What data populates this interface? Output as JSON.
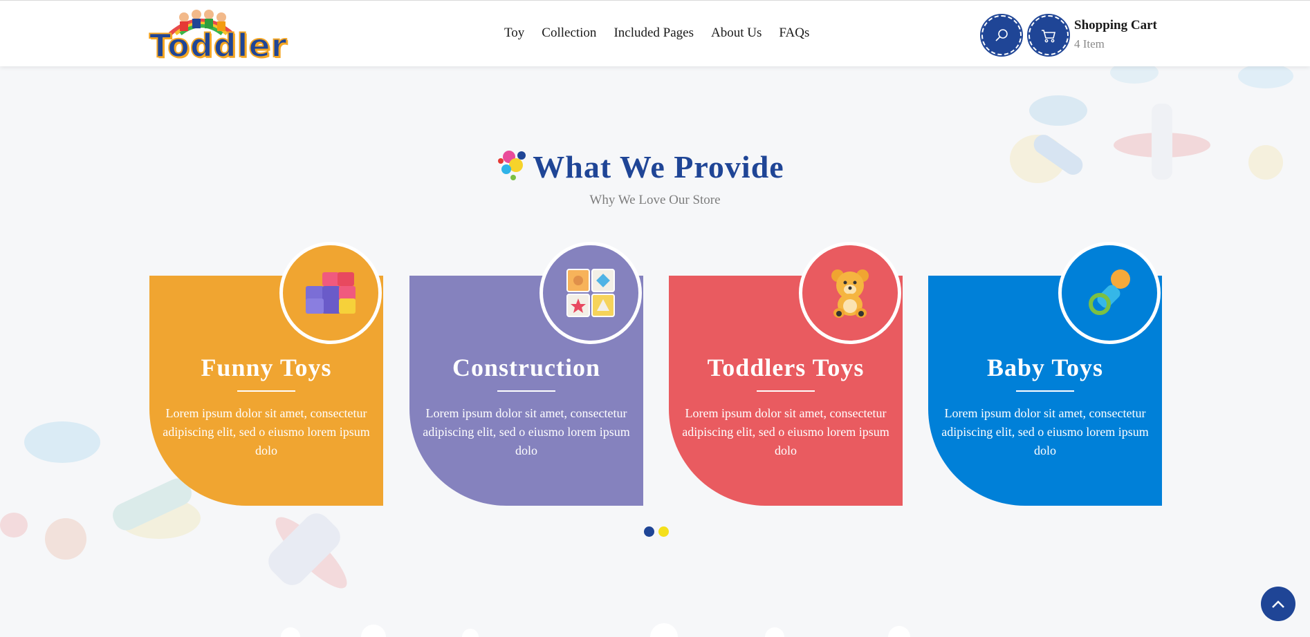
{
  "brand": {
    "logo_text": "Toddler"
  },
  "nav": {
    "items": [
      "Toy",
      "Collection",
      "Included Pages",
      "About Us",
      "FAQs"
    ]
  },
  "header": {
    "search_icon": "search-icon",
    "cart_icon": "cart-icon",
    "cart_title": "Shopping Cart",
    "cart_count": "4 Item"
  },
  "section": {
    "title": "What We Provide",
    "subtitle": "Why We Love Our Store"
  },
  "cards": [
    {
      "title": "Funny Toys",
      "text": "Lorem ipsum dolor sit amet, consectetur adipiscing elit, sed o eiusmo lorem ipsum dolo",
      "color": "#f0a531",
      "icon": "blocks-icon"
    },
    {
      "title": "Construction",
      "text": "Lorem ipsum dolor sit amet, consectetur adipiscing elit, sed o eiusmo lorem ipsum dolo",
      "color": "#8582be",
      "icon": "abc-blocks-icon"
    },
    {
      "title": "Toddlers Toys",
      "text": "Lorem ipsum dolor sit amet, consectetur adipiscing elit, sed o eiusmo lorem ipsum dolo",
      "color": "#e95b60",
      "icon": "teddy-bear-icon"
    },
    {
      "title": "Baby Toys",
      "text": "Lorem ipsum dolor sit amet, consectetur adipiscing elit, sed o eiusmo lorem ipsum dolo",
      "color": "#0080d8",
      "icon": "pacifier-icon"
    }
  ],
  "carousel": {
    "dot_colors": [
      "#1f4596",
      "#f4e01c"
    ],
    "active_index": 0
  },
  "colors": {
    "primary": "#1f4596",
    "accent": "#f5a623"
  },
  "scroll_top_icon": "chevron-up-icon"
}
